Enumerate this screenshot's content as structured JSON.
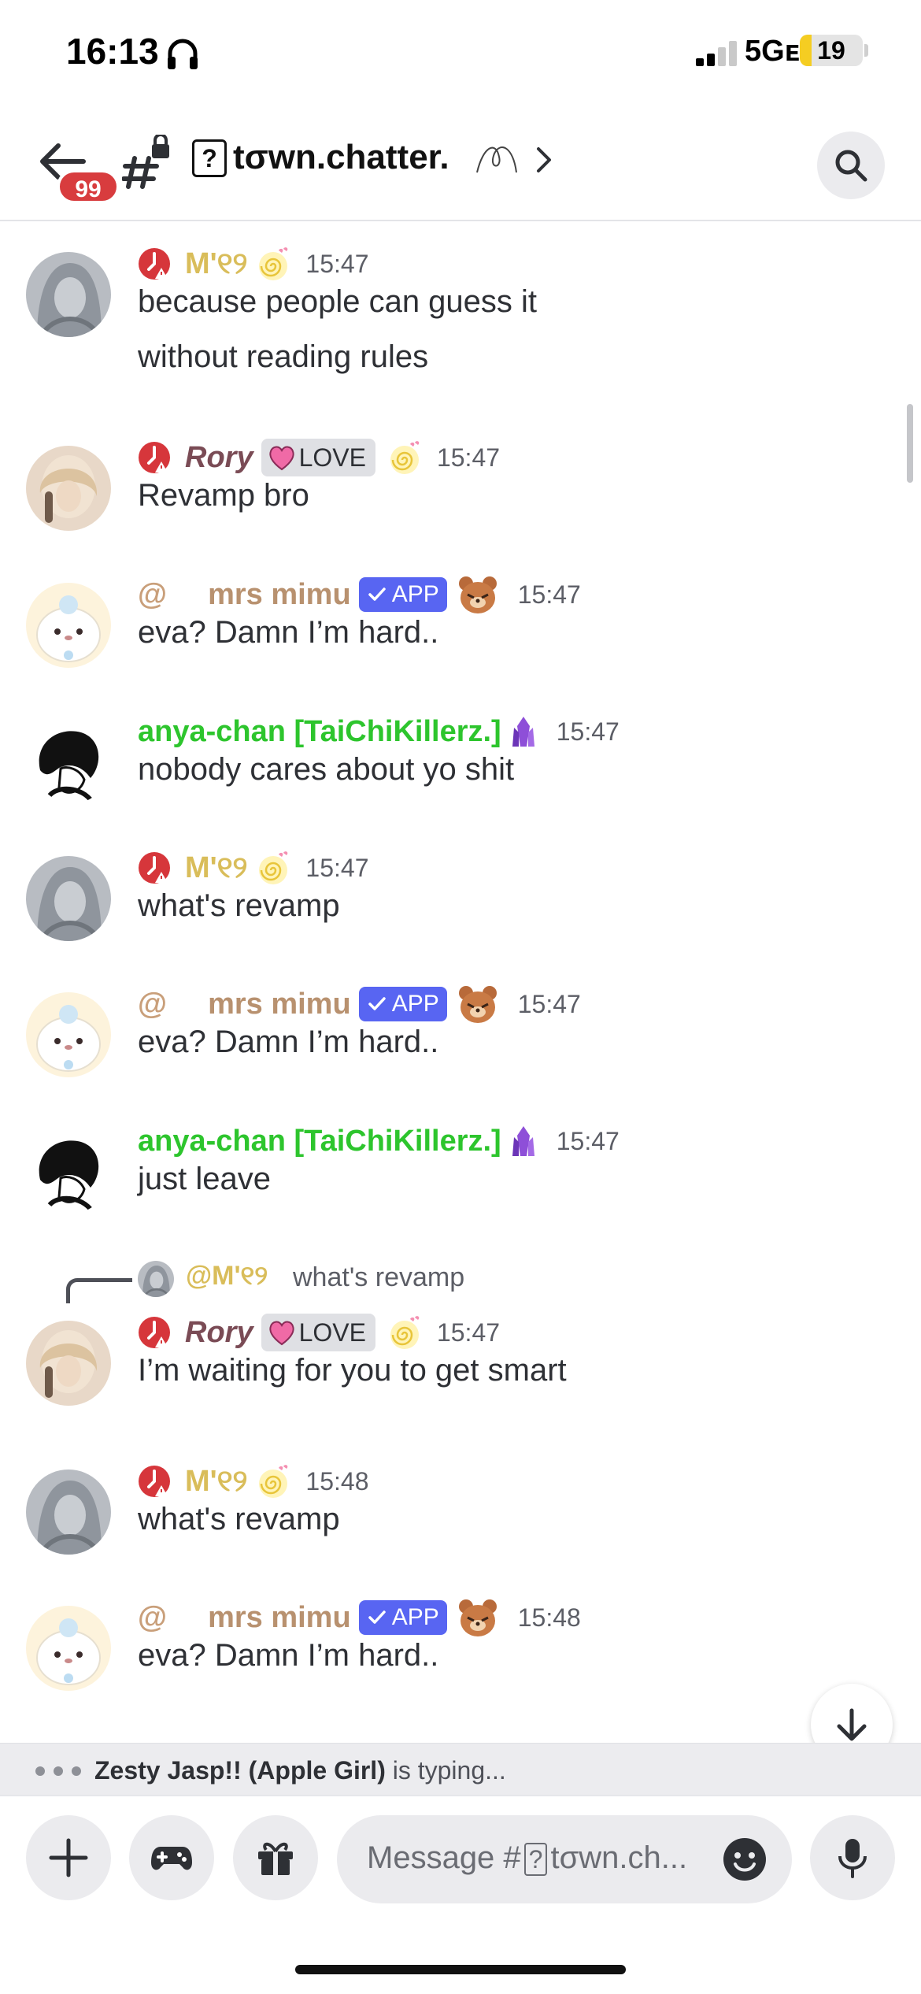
{
  "status_bar": {
    "time": "16:13",
    "network": "5Gᴇ",
    "battery": "19",
    "battery_level": 0.19
  },
  "header": {
    "back_badge": "99",
    "channel_icon_glyph": "?",
    "channel_name": "tσwn.chatter.",
    "colors": {
      "badge": "#d83c3e",
      "accent": "#5865f2"
    }
  },
  "messages": [
    {
      "author": "M'୧୨",
      "time": "15:47",
      "author_color": "#d9bd5a",
      "lines": [
        "because people can guess it",
        "without reading rules"
      ]
    },
    {
      "author": "Rory",
      "badge": "LOVE",
      "time": "15:47",
      "author_color": "#7a4b55",
      "lines": [
        "Revamp bro"
      ]
    },
    {
      "prefix": "@",
      "author": "mrs mimu",
      "badge": "APP",
      "time": "15:47",
      "author_color": "#b8916f",
      "lines": [
        "eva? Damn I’m hard.."
      ]
    },
    {
      "author": "anya-chan [TaiChiKillerz.]",
      "time": "15:47",
      "author_color": "#2dc52d",
      "lines": [
        "nobody cares about yo shit"
      ]
    },
    {
      "author": "M'୧୨",
      "time": "15:47",
      "author_color": "#d9bd5a",
      "lines": [
        "what's revamp"
      ]
    },
    {
      "prefix": "@",
      "author": "mrs mimu",
      "badge": "APP",
      "time": "15:47",
      "author_color": "#b8916f",
      "lines": [
        "eva? Damn I’m hard.."
      ]
    },
    {
      "author": "anya-chan [TaiChiKillerz.]",
      "time": "15:47",
      "author_color": "#2dc52d",
      "lines": [
        "just leave"
      ]
    },
    {
      "reply_to": "@M'୧୨",
      "reply_text": "what's revamp",
      "author": "Rory",
      "badge": "LOVE",
      "time": "15:47",
      "author_color": "#7a4b55",
      "lines": [
        "I’m waiting for you to get smart"
      ]
    },
    {
      "author": "M'୧୨",
      "time": "15:48",
      "author_color": "#d9bd5a",
      "lines": [
        "what's revamp"
      ]
    },
    {
      "prefix": "@",
      "author": "mrs mimu",
      "badge": "APP",
      "time": "15:48",
      "author_color": "#b8916f",
      "lines": [
        "eva? Damn I’m hard.."
      ]
    }
  ],
  "typing": {
    "user": "Zesty Jasp!! (Apple Girl)",
    "suffix": " is typing..."
  },
  "composer": {
    "placeholder_prefix": "Message #",
    "placeholder_glyph": "?",
    "placeholder_channel": "tσwn.ch..."
  },
  "icons": [
    "back-arrow-icon",
    "hash-lock-icon",
    "chevron-right-icon",
    "search-icon",
    "headphones-icon",
    "signal-icon",
    "plus-icon",
    "gamepad-icon",
    "gift-icon",
    "emoji-icon",
    "microphone-icon",
    "arrow-down-icon",
    "role-icon",
    "heart-icon",
    "check-icon",
    "bear-emoji-icon",
    "crystal-icon",
    "spiral-emoji-icon"
  ]
}
